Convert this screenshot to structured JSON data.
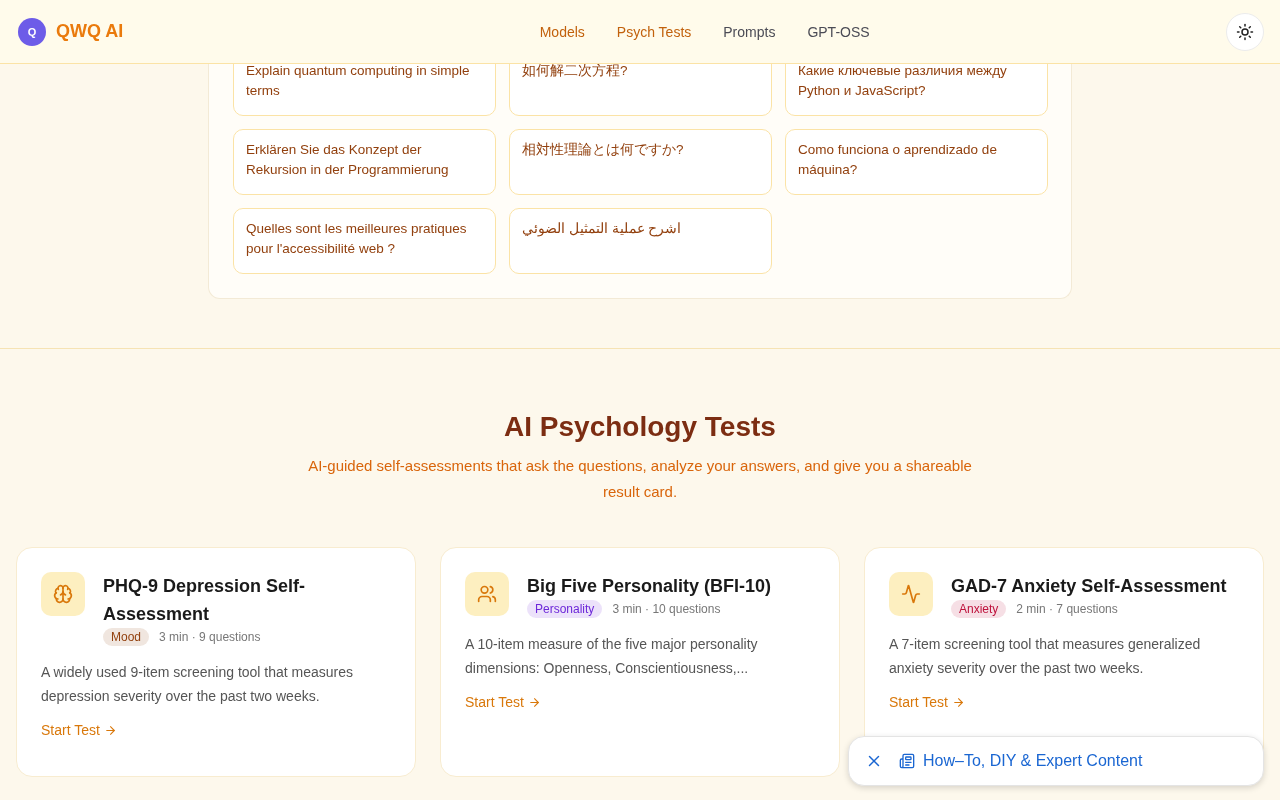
{
  "header": {
    "logo_letter": "Q",
    "brand": "QWQ AI",
    "nav": [
      {
        "label": "Models",
        "selected": true
      },
      {
        "label": "Psych Tests",
        "selected": true
      },
      {
        "label": "Prompts",
        "selected": false
      },
      {
        "label": "GPT-OSS",
        "selected": false
      }
    ]
  },
  "prompts": [
    "Explain quantum computing in simple terms",
    "如何解二次方程?",
    "Какие ключевые различия между Python и JavaScript?",
    "Erklären Sie das Konzept der Rekursion in der Programmierung",
    "相対性理論とは何ですか?",
    "Como funciona o aprendizado de máquina?",
    "Quelles sont les meilleures pratiques pour l'accessibilité web ?",
    "اشرح عملية التمثيل الضوئي"
  ],
  "tests_section": {
    "title": "AI Psychology Tests",
    "subtitle": "AI-guided self-assessments that ask the questions, analyze your answers, and give you a shareable result card.",
    "tests": [
      {
        "title": "PHQ-9 Depression Self-Assessment",
        "tag": "Mood",
        "color": "#92400e",
        "meta": "3 min · 9 questions",
        "description": "A widely used 9-item screening tool that measures depression severity over the past two weeks.",
        "action": "Start Test"
      },
      {
        "title": "Big Five Personality (BFI-10)",
        "tag": "Personality",
        "color": "#6d28d9",
        "meta": "3 min · 10 questions",
        "description": "A 10-item measure of the five major personality dimensions: Openness, Conscientiousness,...",
        "action": "Start Test"
      },
      {
        "title": "GAD-7 Anxiety Self-Assessment",
        "tag": "Anxiety",
        "color": "#be123c",
        "meta": "2 min · 7 questions",
        "description": "A 7-item screening tool that measures generalized anxiety severity over the past two weeks.",
        "action": "Start Test"
      }
    ]
  },
  "floating_bar": {
    "label": "How–To, DIY & Expert Content"
  }
}
